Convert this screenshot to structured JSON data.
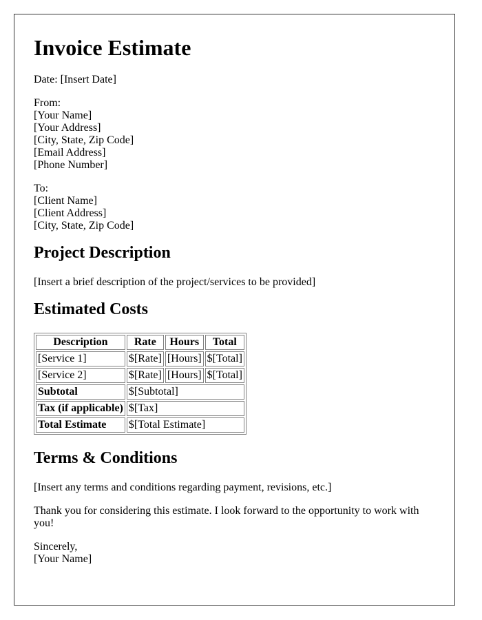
{
  "title": "Invoice Estimate",
  "date_line": "Date: [Insert Date]",
  "from": {
    "label": "From:",
    "lines": [
      "[Your Name]",
      "[Your Address]",
      "[City, State, Zip Code]",
      "[Email Address]",
      "[Phone Number]"
    ]
  },
  "to": {
    "label": "To:",
    "lines": [
      "[Client Name]",
      "[Client Address]",
      "[City, State, Zip Code]"
    ]
  },
  "project": {
    "heading": "Project Description",
    "text": "[Insert a brief description of the project/services to be provided]"
  },
  "costs": {
    "heading": "Estimated Costs",
    "headers": [
      "Description",
      "Rate",
      "Hours",
      "Total"
    ],
    "rows": [
      [
        "[Service 1]",
        "$[Rate]",
        "[Hours]",
        "$[Total]"
      ],
      [
        "[Service 2]",
        "$[Rate]",
        "[Hours]",
        "$[Total]"
      ]
    ],
    "summary": [
      {
        "label": "Subtotal",
        "value": "$[Subtotal]"
      },
      {
        "label": "Tax (if applicable)",
        "value": "$[Tax]"
      },
      {
        "label": "Total Estimate",
        "value": "$[Total Estimate]"
      }
    ]
  },
  "terms": {
    "heading": "Terms & Conditions",
    "text": "[Insert any terms and conditions regarding payment, revisions, etc.]"
  },
  "closing": {
    "thanks": "Thank you for considering this estimate. I look forward to the opportunity to work with you!",
    "signoff": "Sincerely,",
    "name": "[Your Name]"
  }
}
